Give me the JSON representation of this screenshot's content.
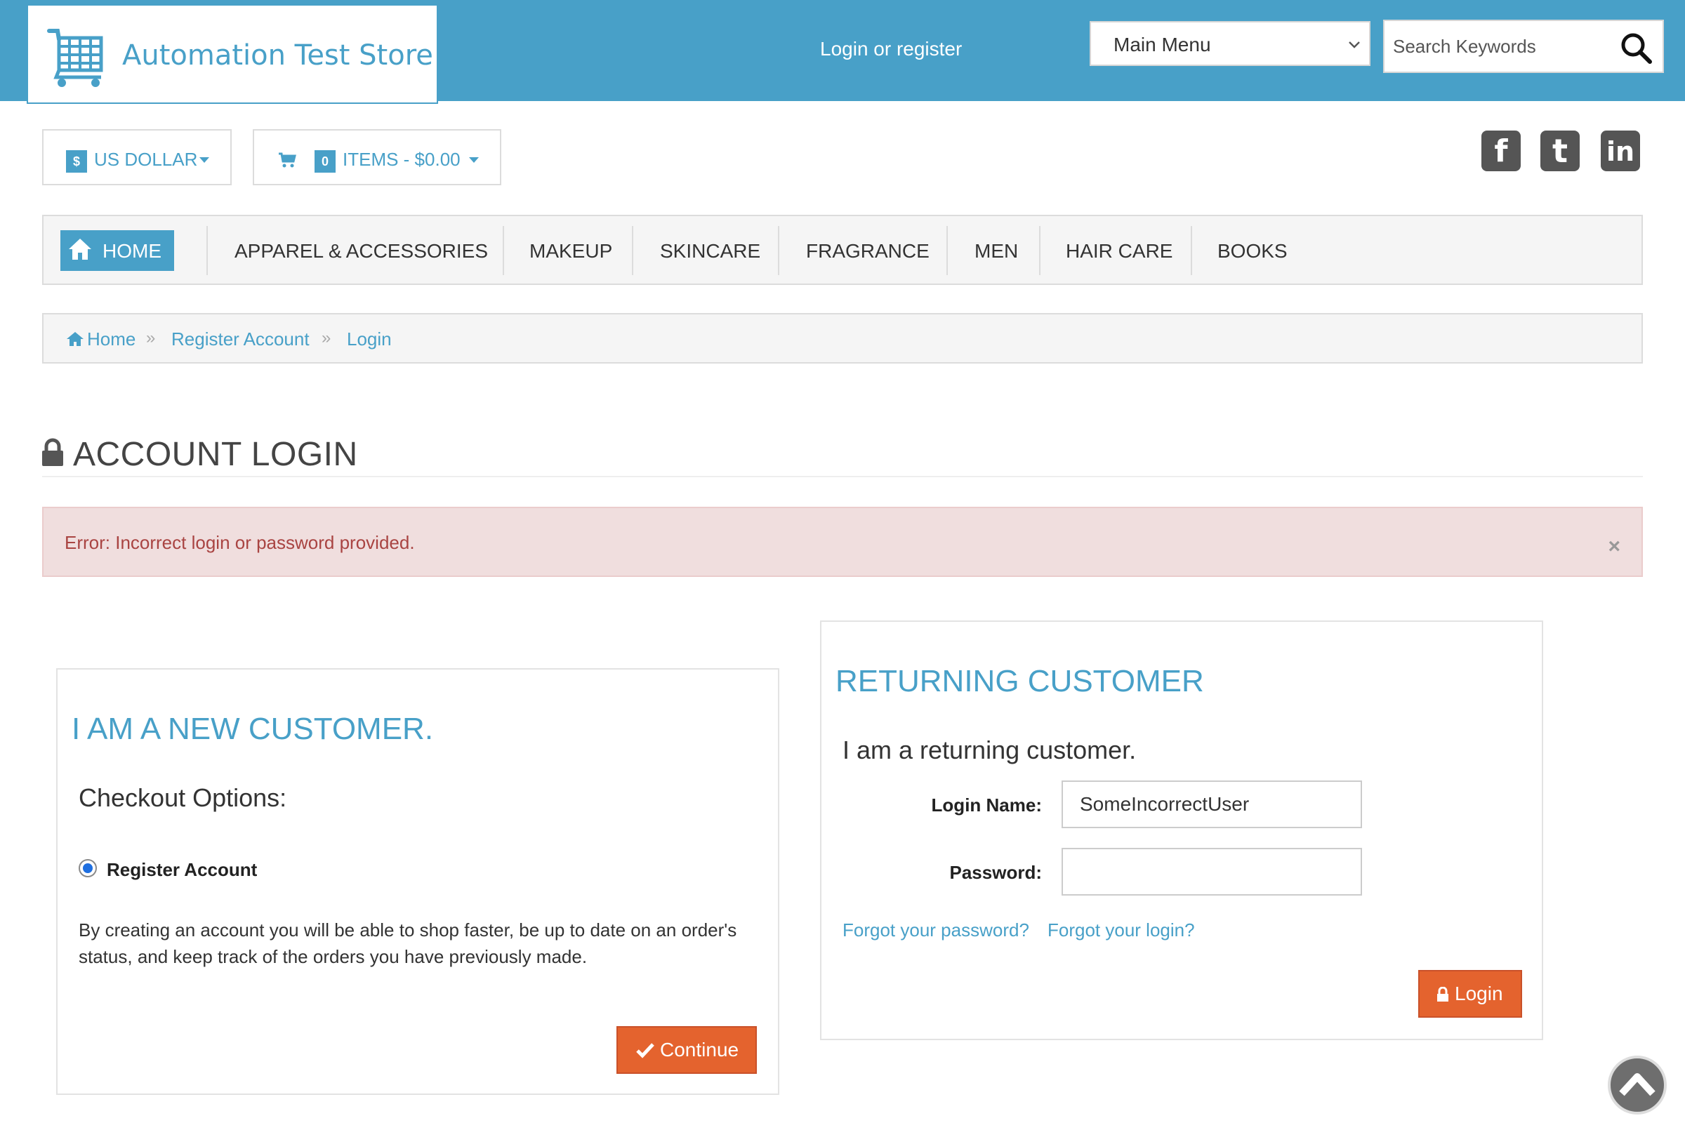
{
  "header": {
    "store_name": "Automation Test Store",
    "login_link": "Login or register",
    "main_menu": "Main Menu",
    "search_placeholder": "Search Keywords"
  },
  "currency": {
    "symbol": "$",
    "label": "US DOLLAR"
  },
  "cart": {
    "count": "0",
    "label": "ITEMS - $0.00"
  },
  "social": [
    "facebook-icon",
    "twitter-icon",
    "linkedin-icon"
  ],
  "nav": {
    "home": "HOME",
    "items": [
      "APPAREL & ACCESSORIES",
      "MAKEUP",
      "SKINCARE",
      "FRAGRANCE",
      "MEN",
      "HAIR CARE",
      "BOOKS"
    ]
  },
  "breadcrumb": [
    "Home",
    "Register Account",
    "Login"
  ],
  "page_title": "ACCOUNT LOGIN",
  "alert": {
    "message": "Error: Incorrect login or password provided.",
    "close": "×"
  },
  "new_customer": {
    "title": "I AM A NEW CUSTOMER.",
    "checkout_options": "Checkout Options:",
    "option_label": "Register Account",
    "description": "By creating an account you will be able to shop faster, be up to date on an order's status, and keep track of the orders you have previously made.",
    "continue_label": "Continue"
  },
  "returning_customer": {
    "title": "RETURNING CUSTOMER",
    "subtitle": "I am a returning customer.",
    "login_name_label": "Login Name:",
    "login_name_value": "SomeIncorrectUser",
    "password_label": "Password:",
    "password_value": "",
    "forgot_password": "Forgot your password?",
    "forgot_login": "Forgot your login?",
    "login_label": "Login"
  },
  "colors": {
    "brand": "#48a0c8",
    "accent": "#e4632e",
    "alert_bg": "#f0dede",
    "alert_text": "#a94442"
  }
}
